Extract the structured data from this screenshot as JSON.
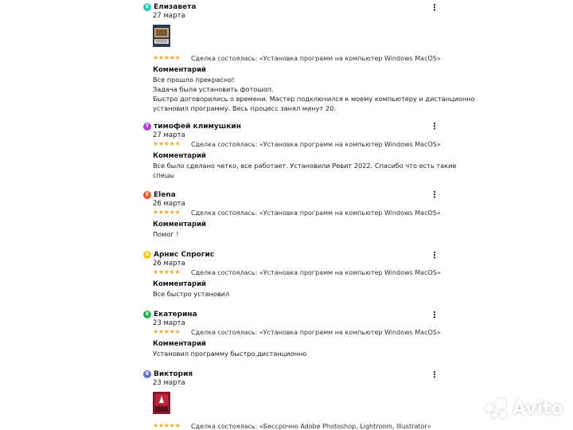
{
  "colors": {
    "star": "#f5a623"
  },
  "deal_prefix": "Сделка состоялась:",
  "comment_title": "Комментарий",
  "reviews": [
    {
      "avatar_letter": "Е",
      "avatar_color": "#2ec4b6",
      "name": "Елизавета",
      "date": "27 марта",
      "stars": "★★★★★",
      "deal": "«Установка программ на компьютер Windows MacOS»",
      "comment_lines": [
        "Все прошло прекрасно!",
        "Задача была установить фотошоп.",
        "Быстро договорились о времени. Мастер подключился к моему компьютеру и дистанционно",
        "установил программу. Весь процесс занял минут 20."
      ]
    },
    {
      "avatar_letter": "Т",
      "avatar_color": "#b23fd6",
      "name": "тимофей климушкин",
      "date": "27 марта",
      "stars": "★★★★★",
      "deal": "«Установка программ на компьютер Windows MacOS»",
      "comment_lines": [
        "Все было сделано четко, все работает. Установили Ревит 2022. Спасибо что есть такие",
        "спецы"
      ]
    },
    {
      "avatar_letter": "E",
      "avatar_color": "#e8582a",
      "name": "Elena",
      "date": "26 марта",
      "stars": "★★★★★",
      "deal": "«Установка программ на компьютер Windows MacOS»",
      "comment_lines": [
        "Помог !"
      ]
    },
    {
      "avatar_letter": "А",
      "avatar_color": "#f5c518",
      "name": "Арнис Спрогис",
      "date": "26 марта",
      "stars": "★★★★★",
      "deal": "«Установка программ на компьютер Windows MacOS»",
      "comment_lines": [
        "Все быстро установил"
      ]
    },
    {
      "avatar_letter": "Е",
      "avatar_color": "#22b14c",
      "name": "Екатерина",
      "date": "23 марта",
      "stars": "★★★★★",
      "deal": "«Установка программ на компьютер Windows MacOS»",
      "comment_lines": [
        "Установил программу быстро,дистанционно"
      ]
    },
    {
      "avatar_letter": "В",
      "avatar_color": "#5b6ee1",
      "name": "Виктория",
      "date": "23 марта",
      "stars": "★★★★★",
      "deal": "«Бессрочно Adobe Photoshop, Lightroom, Illustrator»",
      "comment_lines": []
    }
  ],
  "menu_icon": "more-vertical-icon",
  "watermark": {
    "text": "Avito"
  }
}
